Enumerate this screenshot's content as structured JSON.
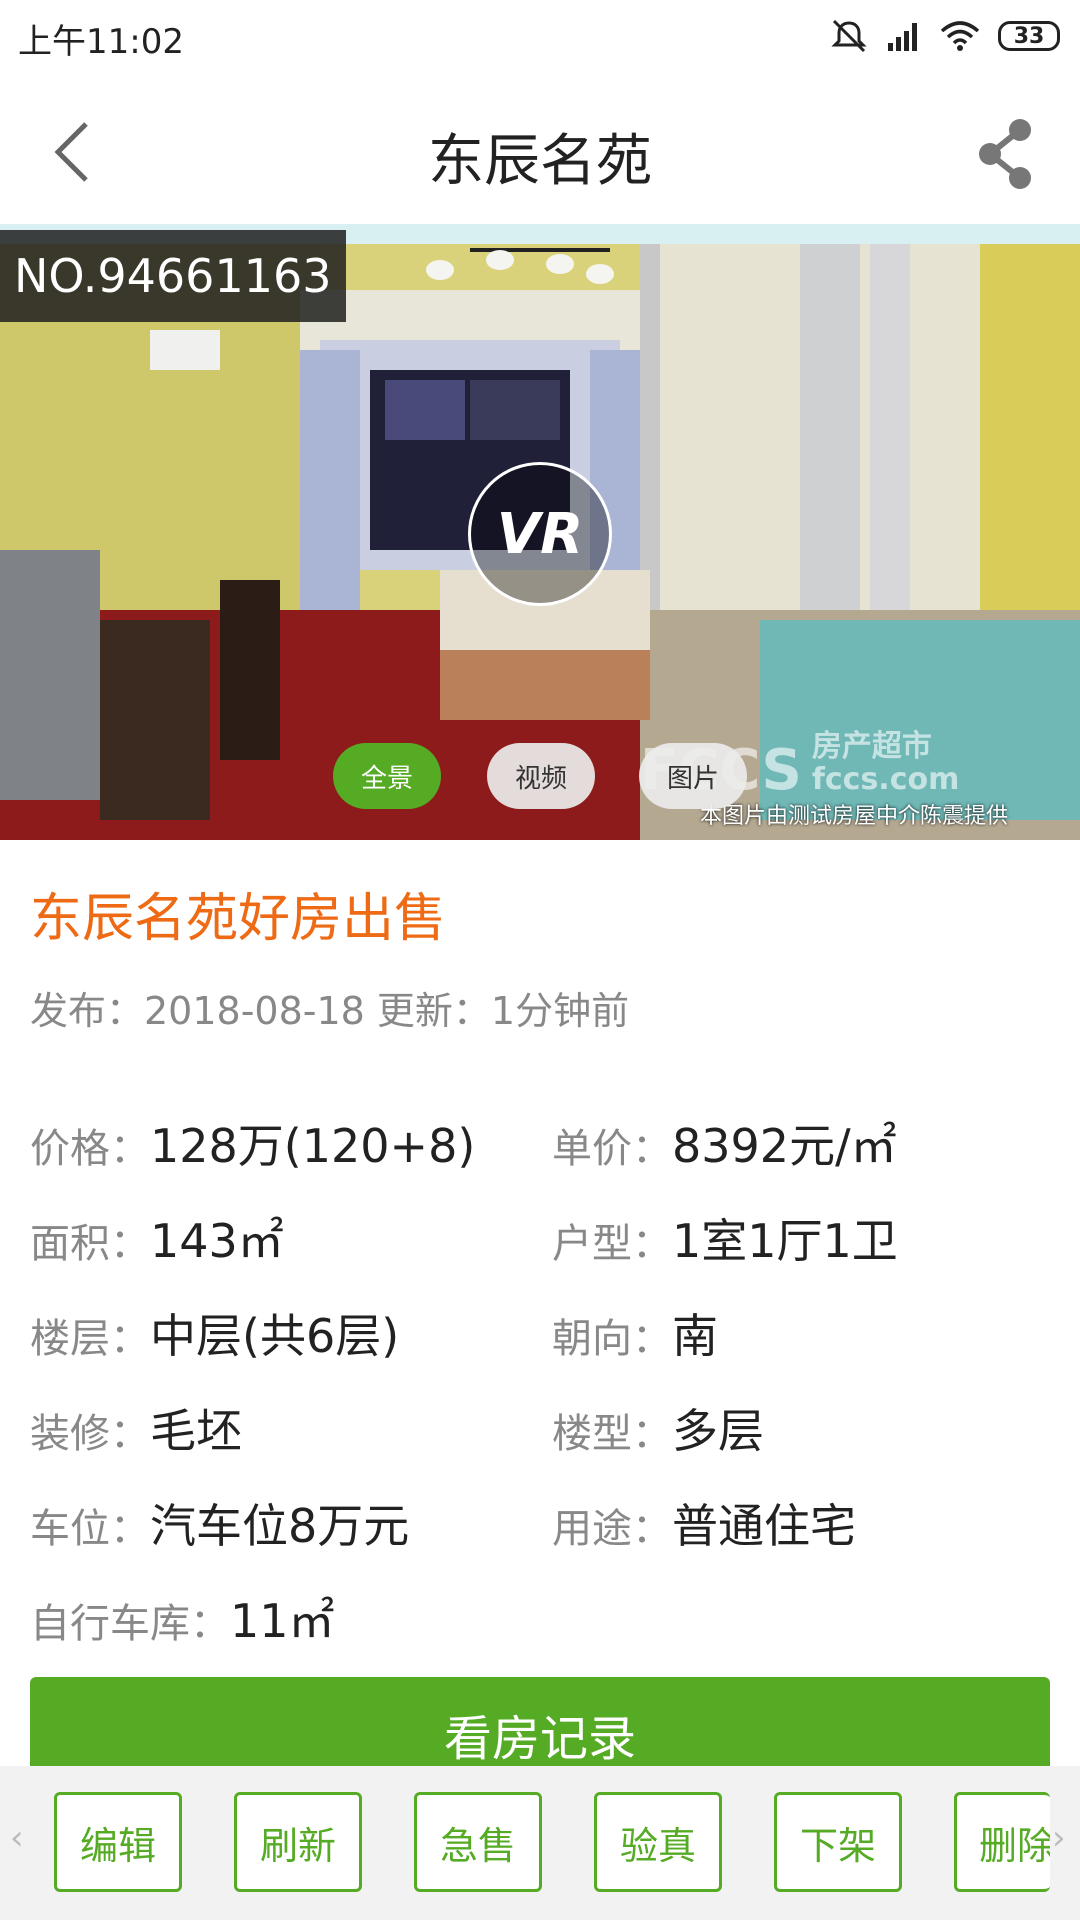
{
  "status_bar": {
    "time": "上午11:02",
    "battery": "33"
  },
  "header": {
    "title": "东辰名苑"
  },
  "hero": {
    "listing_no": "NO.94661163",
    "vr_label": "VR",
    "tabs": [
      {
        "label": "全景",
        "active": true
      },
      {
        "label": "视频",
        "active": false
      },
      {
        "label": "图片",
        "active": false
      }
    ],
    "brand_text": "房产超市",
    "brand_domain": "fccs.com",
    "watermark": "本图片由测试房屋中介陈震提供"
  },
  "listing": {
    "title": "东辰名苑好房出售",
    "meta": "发布：2018-08-18 更新：1分钟前"
  },
  "details": [
    {
      "label": "价格：",
      "value": "128万(120+8)"
    },
    {
      "label": "单价：",
      "value": "8392元/㎡"
    },
    {
      "label": "面积：",
      "value": "143㎡"
    },
    {
      "label": "户型：",
      "value": "1室1厅1卫"
    },
    {
      "label": "楼层：",
      "value": "中层(共6层)"
    },
    {
      "label": "朝向：",
      "value": "南"
    },
    {
      "label": "装修：",
      "value": "毛坯"
    },
    {
      "label": "楼型：",
      "value": "多层"
    },
    {
      "label": "车位：",
      "value": "汽车位8万元"
    },
    {
      "label": "用途：",
      "value": "普通住宅"
    },
    {
      "label": "自行车库：",
      "value": "11㎡"
    }
  ],
  "primary_button": "看房记录",
  "toolbar": {
    "left_arrow": "‹",
    "right_arrow": "›",
    "buttons": [
      "编辑",
      "刷新",
      "急售",
      "验真",
      "下架",
      "删除"
    ]
  },
  "colors": {
    "accent": "#56ab24",
    "title_orange": "#ee6a14"
  }
}
